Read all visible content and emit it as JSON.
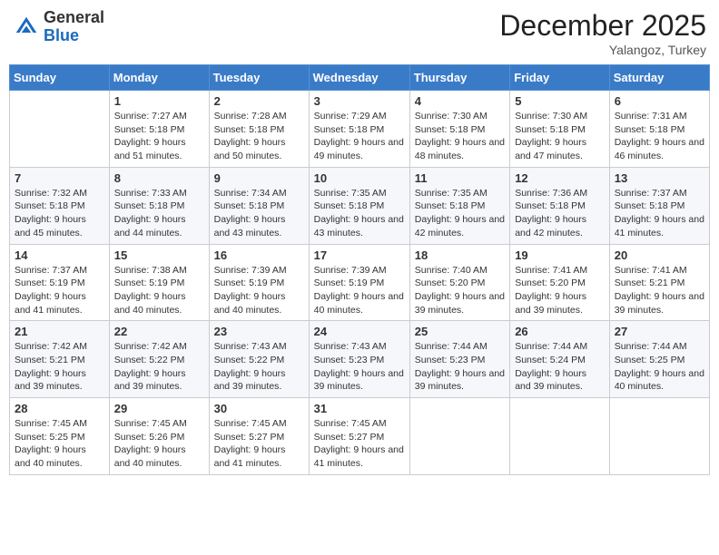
{
  "header": {
    "logo_general": "General",
    "logo_blue": "Blue",
    "month_year": "December 2025",
    "location": "Yalangoz, Turkey"
  },
  "weekdays": [
    "Sunday",
    "Monday",
    "Tuesday",
    "Wednesday",
    "Thursday",
    "Friday",
    "Saturday"
  ],
  "weeks": [
    [
      {
        "day": "",
        "sunrise": "",
        "sunset": "",
        "daylight": ""
      },
      {
        "day": "1",
        "sunrise": "Sunrise: 7:27 AM",
        "sunset": "Sunset: 5:18 PM",
        "daylight": "Daylight: 9 hours and 51 minutes."
      },
      {
        "day": "2",
        "sunrise": "Sunrise: 7:28 AM",
        "sunset": "Sunset: 5:18 PM",
        "daylight": "Daylight: 9 hours and 50 minutes."
      },
      {
        "day": "3",
        "sunrise": "Sunrise: 7:29 AM",
        "sunset": "Sunset: 5:18 PM",
        "daylight": "Daylight: 9 hours and 49 minutes."
      },
      {
        "day": "4",
        "sunrise": "Sunrise: 7:30 AM",
        "sunset": "Sunset: 5:18 PM",
        "daylight": "Daylight: 9 hours and 48 minutes."
      },
      {
        "day": "5",
        "sunrise": "Sunrise: 7:30 AM",
        "sunset": "Sunset: 5:18 PM",
        "daylight": "Daylight: 9 hours and 47 minutes."
      },
      {
        "day": "6",
        "sunrise": "Sunrise: 7:31 AM",
        "sunset": "Sunset: 5:18 PM",
        "daylight": "Daylight: 9 hours and 46 minutes."
      }
    ],
    [
      {
        "day": "7",
        "sunrise": "Sunrise: 7:32 AM",
        "sunset": "Sunset: 5:18 PM",
        "daylight": "Daylight: 9 hours and 45 minutes."
      },
      {
        "day": "8",
        "sunrise": "Sunrise: 7:33 AM",
        "sunset": "Sunset: 5:18 PM",
        "daylight": "Daylight: 9 hours and 44 minutes."
      },
      {
        "day": "9",
        "sunrise": "Sunrise: 7:34 AM",
        "sunset": "Sunset: 5:18 PM",
        "daylight": "Daylight: 9 hours and 43 minutes."
      },
      {
        "day": "10",
        "sunrise": "Sunrise: 7:35 AM",
        "sunset": "Sunset: 5:18 PM",
        "daylight": "Daylight: 9 hours and 43 minutes."
      },
      {
        "day": "11",
        "sunrise": "Sunrise: 7:35 AM",
        "sunset": "Sunset: 5:18 PM",
        "daylight": "Daylight: 9 hours and 42 minutes."
      },
      {
        "day": "12",
        "sunrise": "Sunrise: 7:36 AM",
        "sunset": "Sunset: 5:18 PM",
        "daylight": "Daylight: 9 hours and 42 minutes."
      },
      {
        "day": "13",
        "sunrise": "Sunrise: 7:37 AM",
        "sunset": "Sunset: 5:18 PM",
        "daylight": "Daylight: 9 hours and 41 minutes."
      }
    ],
    [
      {
        "day": "14",
        "sunrise": "Sunrise: 7:37 AM",
        "sunset": "Sunset: 5:19 PM",
        "daylight": "Daylight: 9 hours and 41 minutes."
      },
      {
        "day": "15",
        "sunrise": "Sunrise: 7:38 AM",
        "sunset": "Sunset: 5:19 PM",
        "daylight": "Daylight: 9 hours and 40 minutes."
      },
      {
        "day": "16",
        "sunrise": "Sunrise: 7:39 AM",
        "sunset": "Sunset: 5:19 PM",
        "daylight": "Daylight: 9 hours and 40 minutes."
      },
      {
        "day": "17",
        "sunrise": "Sunrise: 7:39 AM",
        "sunset": "Sunset: 5:19 PM",
        "daylight": "Daylight: 9 hours and 40 minutes."
      },
      {
        "day": "18",
        "sunrise": "Sunrise: 7:40 AM",
        "sunset": "Sunset: 5:20 PM",
        "daylight": "Daylight: 9 hours and 39 minutes."
      },
      {
        "day": "19",
        "sunrise": "Sunrise: 7:41 AM",
        "sunset": "Sunset: 5:20 PM",
        "daylight": "Daylight: 9 hours and 39 minutes."
      },
      {
        "day": "20",
        "sunrise": "Sunrise: 7:41 AM",
        "sunset": "Sunset: 5:21 PM",
        "daylight": "Daylight: 9 hours and 39 minutes."
      }
    ],
    [
      {
        "day": "21",
        "sunrise": "Sunrise: 7:42 AM",
        "sunset": "Sunset: 5:21 PM",
        "daylight": "Daylight: 9 hours and 39 minutes."
      },
      {
        "day": "22",
        "sunrise": "Sunrise: 7:42 AM",
        "sunset": "Sunset: 5:22 PM",
        "daylight": "Daylight: 9 hours and 39 minutes."
      },
      {
        "day": "23",
        "sunrise": "Sunrise: 7:43 AM",
        "sunset": "Sunset: 5:22 PM",
        "daylight": "Daylight: 9 hours and 39 minutes."
      },
      {
        "day": "24",
        "sunrise": "Sunrise: 7:43 AM",
        "sunset": "Sunset: 5:23 PM",
        "daylight": "Daylight: 9 hours and 39 minutes."
      },
      {
        "day": "25",
        "sunrise": "Sunrise: 7:44 AM",
        "sunset": "Sunset: 5:23 PM",
        "daylight": "Daylight: 9 hours and 39 minutes."
      },
      {
        "day": "26",
        "sunrise": "Sunrise: 7:44 AM",
        "sunset": "Sunset: 5:24 PM",
        "daylight": "Daylight: 9 hours and 39 minutes."
      },
      {
        "day": "27",
        "sunrise": "Sunrise: 7:44 AM",
        "sunset": "Sunset: 5:25 PM",
        "daylight": "Daylight: 9 hours and 40 minutes."
      }
    ],
    [
      {
        "day": "28",
        "sunrise": "Sunrise: 7:45 AM",
        "sunset": "Sunset: 5:25 PM",
        "daylight": "Daylight: 9 hours and 40 minutes."
      },
      {
        "day": "29",
        "sunrise": "Sunrise: 7:45 AM",
        "sunset": "Sunset: 5:26 PM",
        "daylight": "Daylight: 9 hours and 40 minutes."
      },
      {
        "day": "30",
        "sunrise": "Sunrise: 7:45 AM",
        "sunset": "Sunset: 5:27 PM",
        "daylight": "Daylight: 9 hours and 41 minutes."
      },
      {
        "day": "31",
        "sunrise": "Sunrise: 7:45 AM",
        "sunset": "Sunset: 5:27 PM",
        "daylight": "Daylight: 9 hours and 41 minutes."
      },
      {
        "day": "",
        "sunrise": "",
        "sunset": "",
        "daylight": ""
      },
      {
        "day": "",
        "sunrise": "",
        "sunset": "",
        "daylight": ""
      },
      {
        "day": "",
        "sunrise": "",
        "sunset": "",
        "daylight": ""
      }
    ]
  ]
}
